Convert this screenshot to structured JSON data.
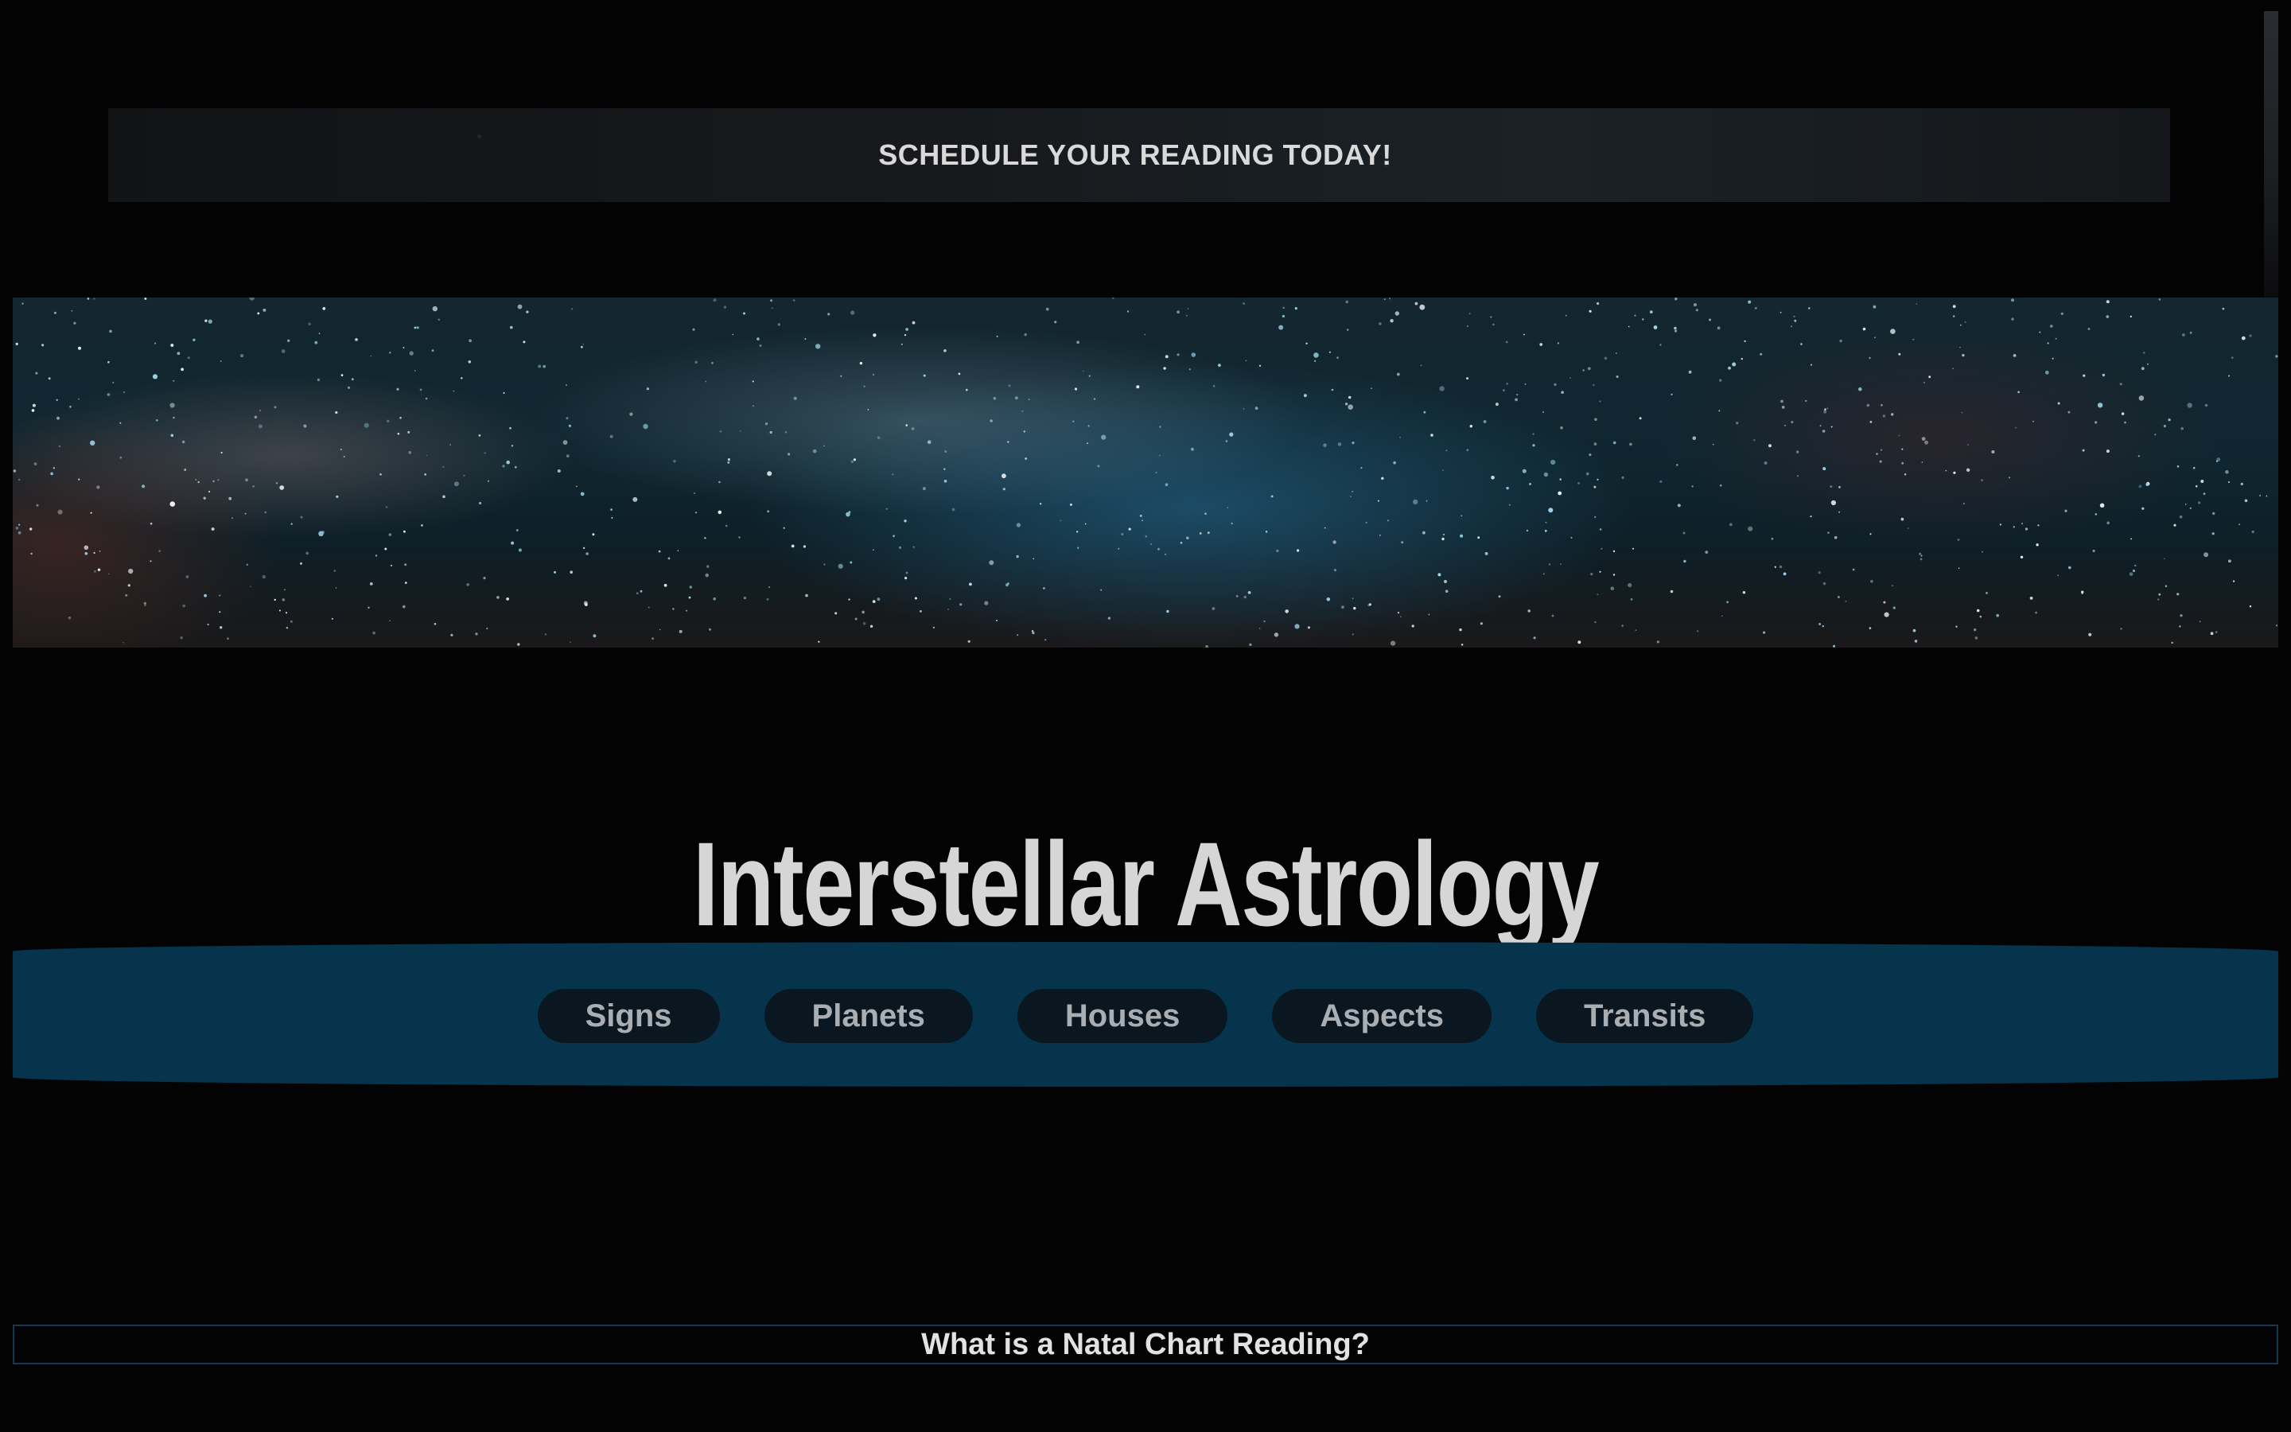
{
  "promo": {
    "text": "SCHEDULE YOUR READING TODAY!"
  },
  "hero": {
    "image": "milky-way-night-sky"
  },
  "site": {
    "title": "Interstellar Astrology"
  },
  "nav": {
    "items": [
      {
        "label": "Signs"
      },
      {
        "label": "Planets"
      },
      {
        "label": "Houses"
      },
      {
        "label": "Aspects"
      },
      {
        "label": "Transits"
      }
    ]
  },
  "section": {
    "heading": "What is a Natal Chart Reading?"
  },
  "colors": {
    "background": "#030303",
    "nav_bar": "#06344c",
    "nav_pill": "#0b1720",
    "nav_text": "#a9aeb3",
    "title_text": "#d6d6d6",
    "section_border": "#0f3a53"
  }
}
